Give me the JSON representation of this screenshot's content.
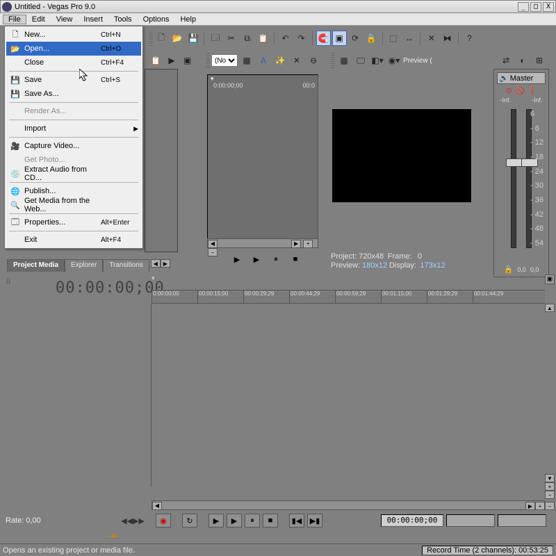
{
  "window": {
    "title": "Untitled - Vegas Pro 9.0"
  },
  "menus": [
    "File",
    "Edit",
    "View",
    "Insert",
    "Tools",
    "Options",
    "Help"
  ],
  "file_menu": [
    {
      "icon": "🗋",
      "label": "New...",
      "shortcut": "Ctrl+N"
    },
    {
      "icon": "📂",
      "label": "Open...",
      "shortcut": "Ctrl+O",
      "sel": true
    },
    {
      "icon": "",
      "label": "Close",
      "shortcut": "Ctrl+F4"
    },
    {
      "sep": true
    },
    {
      "icon": "💾",
      "label": "Save",
      "shortcut": "Ctrl+S"
    },
    {
      "icon": "💾",
      "label": "Save As...",
      "shortcut": ""
    },
    {
      "sep": true
    },
    {
      "icon": "",
      "label": "Render As...",
      "shortcut": "",
      "disabled": true
    },
    {
      "sep": true
    },
    {
      "icon": "",
      "label": "Import",
      "shortcut": "",
      "sub": true
    },
    {
      "sep": true
    },
    {
      "icon": "🎥",
      "label": "Capture Video...",
      "shortcut": ""
    },
    {
      "icon": "",
      "label": "Get Photo...",
      "shortcut": "",
      "disabled": true
    },
    {
      "icon": "💿",
      "label": "Extract Audio from CD...",
      "shortcut": ""
    },
    {
      "sep": true
    },
    {
      "icon": "🌐",
      "label": "Publish...",
      "shortcut": ""
    },
    {
      "icon": "🔍",
      "label": "Get Media from the Web...",
      "shortcut": ""
    },
    {
      "sep": true
    },
    {
      "icon": "🗔",
      "label": "Properties...",
      "shortcut": "Alt+Enter"
    },
    {
      "sep": true
    },
    {
      "icon": "",
      "label": "Exit",
      "shortcut": "Alt+F4"
    }
  ],
  "tabs": [
    "Project Media",
    "Explorer",
    "Transitions"
  ],
  "timecode": "00:00:00;00",
  "ruler": [
    "0:00:00;00",
    "00:00:15;00",
    "00:00:29;29",
    "00:00:44;29",
    "00:00:59;29",
    "00:01:15;00",
    "00:01:29;29",
    "00:01:44;29"
  ],
  "trimmer_time_left": "0:00:00;00",
  "trimmer_time_right": "00:0",
  "project_info": {
    "proj": "Project:",
    "proj_v": "720x48",
    "frame": "Frame:",
    "frame_v": "0",
    "prev": "Preview:",
    "prev_v": "180x12",
    "disp": "Display:",
    "disp_v": "173x12"
  },
  "mixer": {
    "title": "Master",
    "inf": "-Inf.",
    "scale": [
      "6",
      "- 6",
      "- 12",
      "- 18",
      "- 24",
      "- 30",
      "- 36",
      "- 42",
      "- 48",
      "- 54"
    ],
    "bottom_l": "0,0",
    "bottom_r": "0,0"
  },
  "rate_label": "Rate: 0,00",
  "transport_time": "00:00:00;00",
  "status": "Opens an existing project or media file.",
  "record_time": "Record Time (2 channels): 00:53:25",
  "preview_label": "Preview (",
  "dropdown_text": "(No"
}
